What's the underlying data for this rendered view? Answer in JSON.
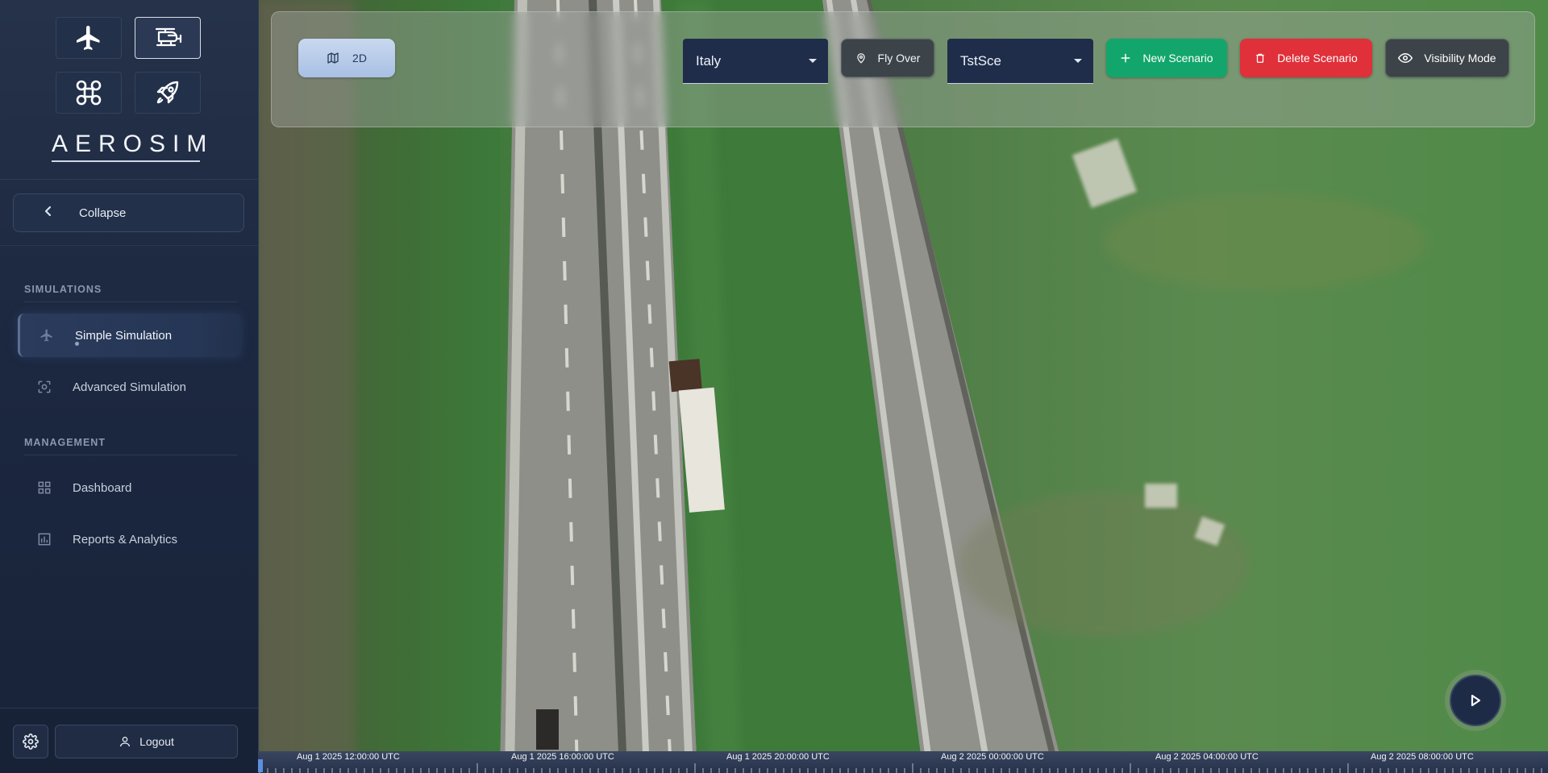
{
  "sidebar": {
    "brand": "AEROSIM",
    "vehicles": [
      {
        "name": "airplane-icon",
        "active": false
      },
      {
        "name": "helicopter-icon",
        "active": true
      },
      {
        "name": "drone-icon",
        "active": false
      },
      {
        "name": "rocket-icon",
        "active": false
      }
    ],
    "collapse_label": "Collapse",
    "sections": [
      {
        "title": "SIMULATIONS",
        "items": [
          {
            "label": "Simple Simulation",
            "icon": "airplane-icon",
            "active": true
          },
          {
            "label": "Advanced Simulation",
            "icon": "scan-icon",
            "active": false
          }
        ]
      },
      {
        "title": "MANAGEMENT",
        "items": [
          {
            "label": "Dashboard",
            "icon": "dashboard-icon",
            "active": false
          },
          {
            "label": "Reports & Analytics",
            "icon": "bar-chart-icon",
            "active": false
          }
        ]
      }
    ],
    "logout_label": "Logout"
  },
  "toolbar": {
    "view_mode_label": "2D",
    "country_value": "Italy",
    "fly_over_label": "Fly Over",
    "scenario_value": "TstSce",
    "new_scenario_label": "New Scenario",
    "delete_scenario_label": "Delete Scenario",
    "visibility_mode_label": "Visibility Mode"
  },
  "timeline": {
    "labels": [
      "Aug 1 2025 12:00:00 UTC",
      "Aug 1 2025 16:00:00 UTC",
      "Aug 1 2025 20:00:00 UTC",
      "Aug 2 2025 00:00:00 UTC",
      "Aug 2 2025 04:00:00 UTC",
      "Aug 2 2025 08:00:00 UTC"
    ]
  },
  "colors": {
    "sidebar_bg": "#1c2840",
    "new_scenario": "#13a66c",
    "delete_scenario": "#e0303a",
    "view_mode": "#b9cdea"
  }
}
